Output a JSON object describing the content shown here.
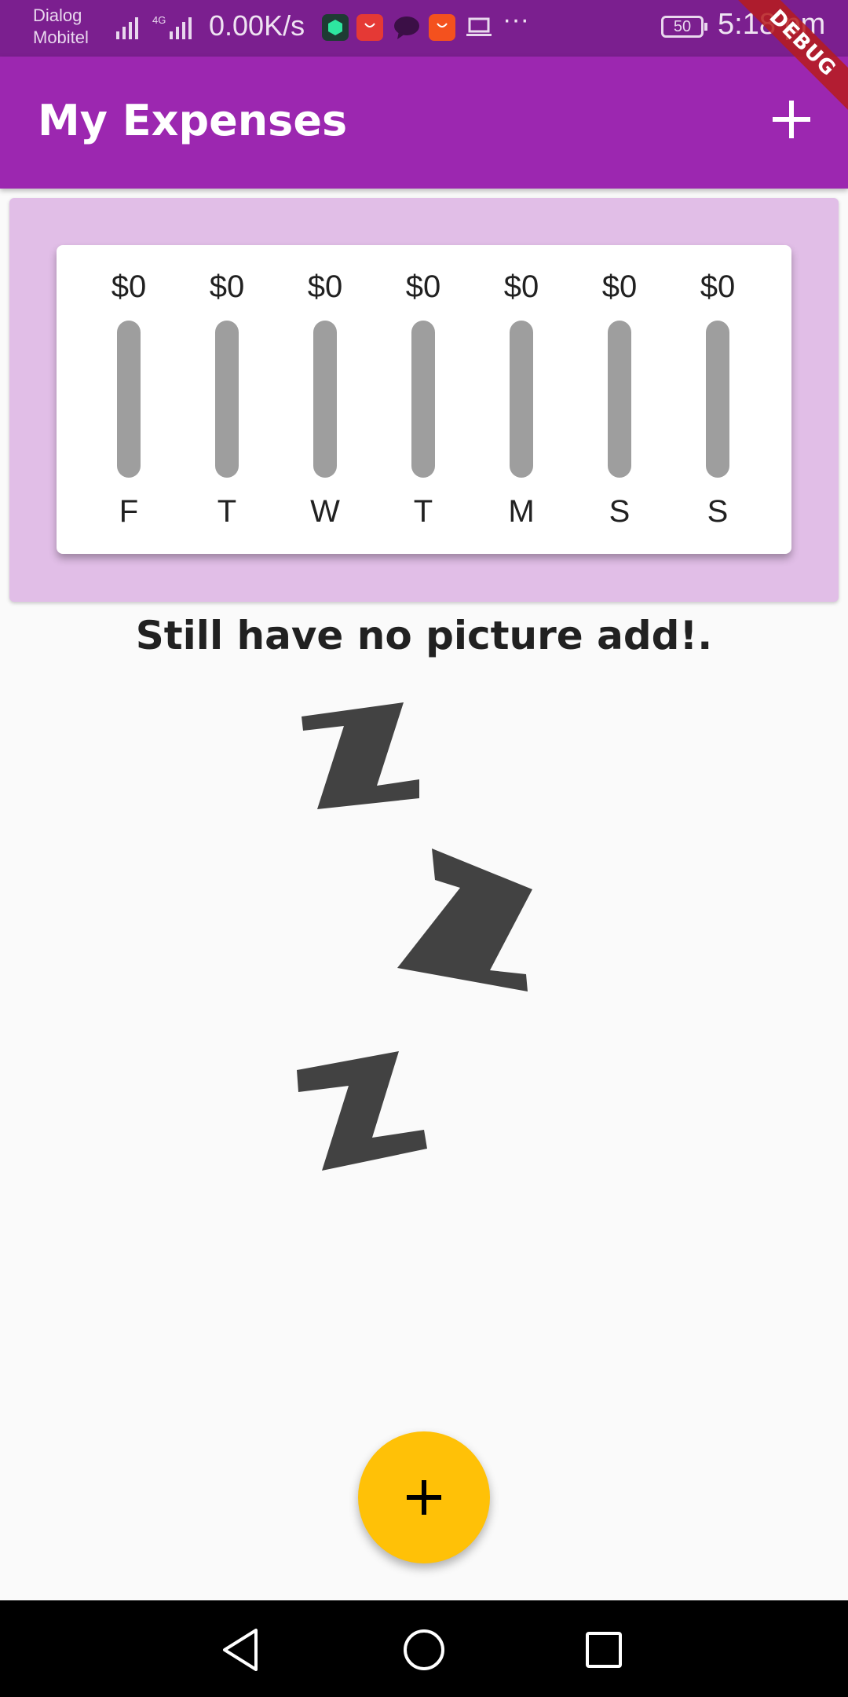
{
  "status_bar": {
    "carrier_line1": "Dialog",
    "carrier_line2": "Mobitel",
    "net_speed": "0.00K/s",
    "battery": "50",
    "time": "5:18 pm",
    "notification_icons": [
      "shield-app-icon",
      "huawei-store-icon",
      "message-icon",
      "aliexpress-icon",
      "laptop-icon"
    ],
    "more": "···"
  },
  "app_bar": {
    "title": "My Expenses",
    "add_icon": "plus-icon",
    "debug_banner": "DEBUG",
    "color": "#9c27b0"
  },
  "chart_data": {
    "type": "bar",
    "categories": [
      "F",
      "T",
      "W",
      "T",
      "M",
      "S",
      "S"
    ],
    "amount_labels": [
      "$0",
      "$0",
      "$0",
      "$0",
      "$0",
      "$0",
      "$0"
    ],
    "values": [
      0,
      0,
      0,
      0,
      0,
      0,
      0
    ],
    "bar_color": "#9e9e9e",
    "fill_color": "#9c27b0",
    "title": "",
    "xlabel": "",
    "ylabel": ""
  },
  "empty_state": {
    "text": "Still have no picture add!.",
    "image": "sleeping-zzz-illustration"
  },
  "fab": {
    "icon": "plus-icon",
    "color": "#ffc107"
  },
  "nav_bar": {
    "buttons": [
      "back-icon",
      "home-icon",
      "recents-icon"
    ]
  }
}
